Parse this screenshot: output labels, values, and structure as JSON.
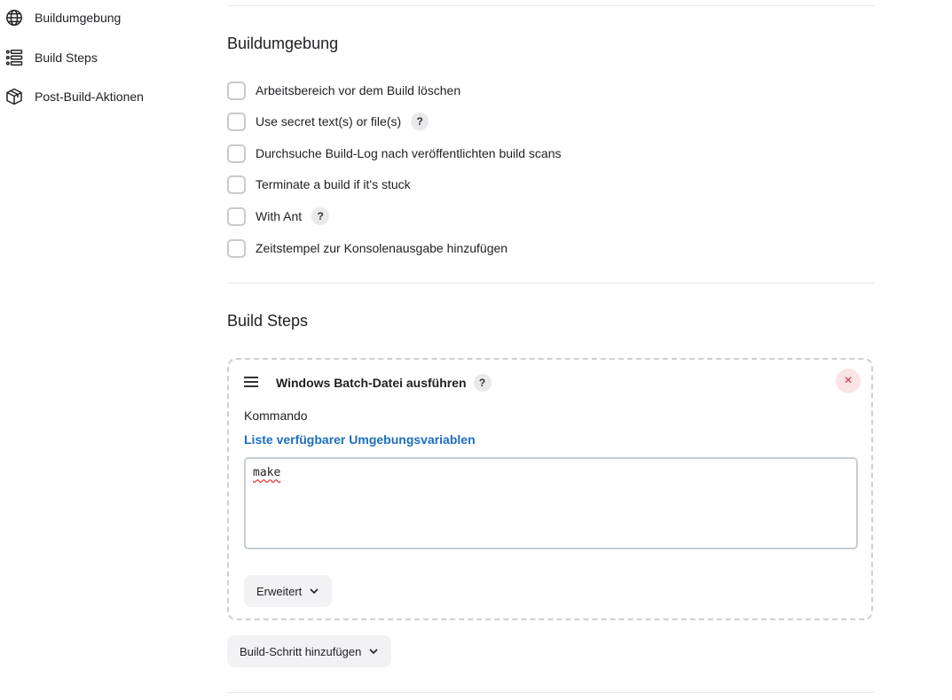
{
  "sidebar": {
    "items": [
      {
        "label": "Buildumgebung",
        "icon": "globe-icon"
      },
      {
        "label": "Build Steps",
        "icon": "list-icon"
      },
      {
        "label": "Post-Build-Aktionen",
        "icon": "package-icon"
      }
    ]
  },
  "build_env": {
    "title": "Buildumgebung",
    "options": [
      {
        "label": "Arbeitsbereich vor dem Build löschen",
        "checked": false,
        "help": false
      },
      {
        "label": "Use secret text(s) or file(s)",
        "checked": false,
        "help": true
      },
      {
        "label": "Durchsuche Build-Log nach veröffentlichten build scans",
        "checked": false,
        "help": false
      },
      {
        "label": "Terminate a build if it's stuck",
        "checked": false,
        "help": false
      },
      {
        "label": "With Ant",
        "checked": false,
        "help": true
      },
      {
        "label": "Zeitstempel zur Konsolenausgabe hinzufügen",
        "checked": false,
        "help": false
      }
    ],
    "help_glyph": "?"
  },
  "build_steps": {
    "title": "Build Steps",
    "step": {
      "title": "Windows Batch-Datei ausführen",
      "help_glyph": "?",
      "close_glyph": "×",
      "command_label": "Kommando",
      "env_link": "Liste verfügbarer Umgebungsvariablen",
      "command_value": "make",
      "advanced_label": "Erweitert"
    },
    "add_step_label": "Build-Schritt hinzufügen"
  },
  "colors": {
    "link": "#1b6ec2",
    "close_bg": "#fbe3e6",
    "close_fg": "#d52a3a"
  }
}
